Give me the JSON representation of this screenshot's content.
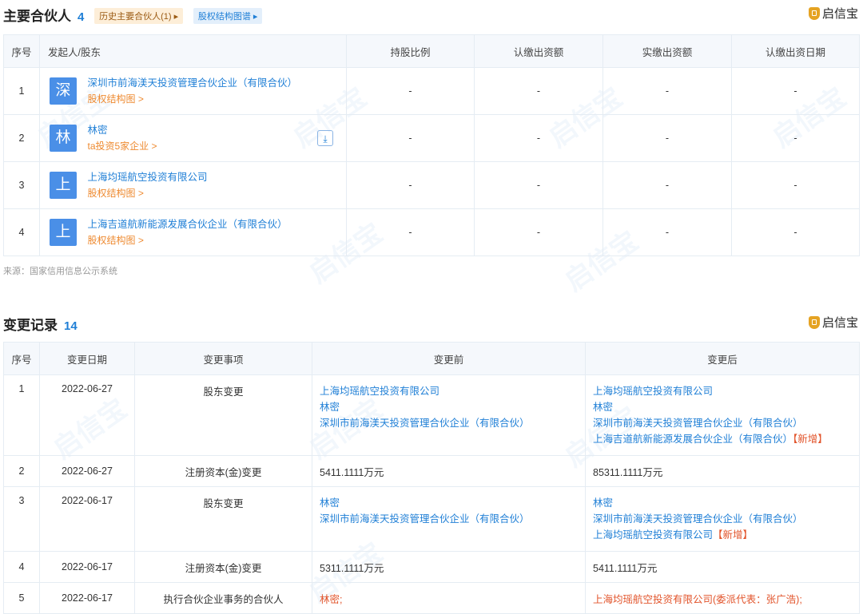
{
  "partners": {
    "title": "主要合伙人",
    "count": "4",
    "history_tag": "历史主要合伙人(1)",
    "structure_tag": "股权结构图谱",
    "brand": "启信宝",
    "columns": [
      "序号",
      "发起人/股东",
      "持股比例",
      "认缴出资额",
      "实缴出资额",
      "认缴出资日期"
    ],
    "rows": [
      {
        "no": "1",
        "avatar": "深",
        "name": "深圳市前海渼天投资管理合伙企业（有限合伙）",
        "sub": "股权结构图 >",
        "ratio": "-",
        "subscribed": "-",
        "paid": "-",
        "date": "-"
      },
      {
        "no": "2",
        "avatar": "林",
        "name": "林密",
        "sub": "ta投资5家企业 >",
        "ratio": "-",
        "subscribed": "-",
        "paid": "-",
        "date": "-"
      },
      {
        "no": "3",
        "avatar": "上",
        "name": "上海均瑶航空投资有限公司",
        "sub": "股权结构图 >",
        "ratio": "-",
        "subscribed": "-",
        "paid": "-",
        "date": "-"
      },
      {
        "no": "4",
        "avatar": "上",
        "name": "上海吉道航新能源发展合伙企业（有限合伙）",
        "sub": "股权结构图 >",
        "ratio": "-",
        "subscribed": "-",
        "paid": "-",
        "date": "-"
      }
    ],
    "source": "来源：国家信用信息公示系统"
  },
  "changes": {
    "title": "变更记录",
    "count": "14",
    "brand": "启信宝",
    "columns": [
      "序号",
      "变更日期",
      "变更事项",
      "变更前",
      "变更后"
    ],
    "rows": [
      {
        "no": "1",
        "date": "2022-06-27",
        "item": "股东变更",
        "before": [
          "上海均瑶航空投资有限公司",
          "林密",
          "深圳市前海渼天投资管理合伙企业（有限合伙）"
        ],
        "after": [
          "上海均瑶航空投资有限公司",
          "林密",
          "深圳市前海渼天投资管理合伙企业（有限合伙）",
          "上海吉道航新能源发展合伙企业（有限合伙）"
        ],
        "after_new": "【新增】"
      },
      {
        "no": "2",
        "date": "2022-06-27",
        "item": "注册资本(金)变更",
        "before_text": "5411.1111万元",
        "after_text": "85311.1111万元"
      },
      {
        "no": "3",
        "date": "2022-06-17",
        "item": "股东变更",
        "before": [
          "林密",
          "深圳市前海渼天投资管理合伙企业（有限合伙）"
        ],
        "after": [
          "林密",
          "深圳市前海渼天投资管理合伙企业（有限合伙）",
          "上海均瑶航空投资有限公司"
        ],
        "after_new": "【新增】"
      },
      {
        "no": "4",
        "date": "2022-06-17",
        "item": "注册资本(金)变更",
        "before_text": "5311.1111万元",
        "after_text": "5411.1111万元"
      },
      {
        "no": "5",
        "date": "2022-06-17",
        "item": "执行合伙企业事务的合伙人",
        "before_text": "林密;",
        "after_text": "上海均瑶航空投资有限公司(委派代表：张广浩);"
      }
    ]
  }
}
